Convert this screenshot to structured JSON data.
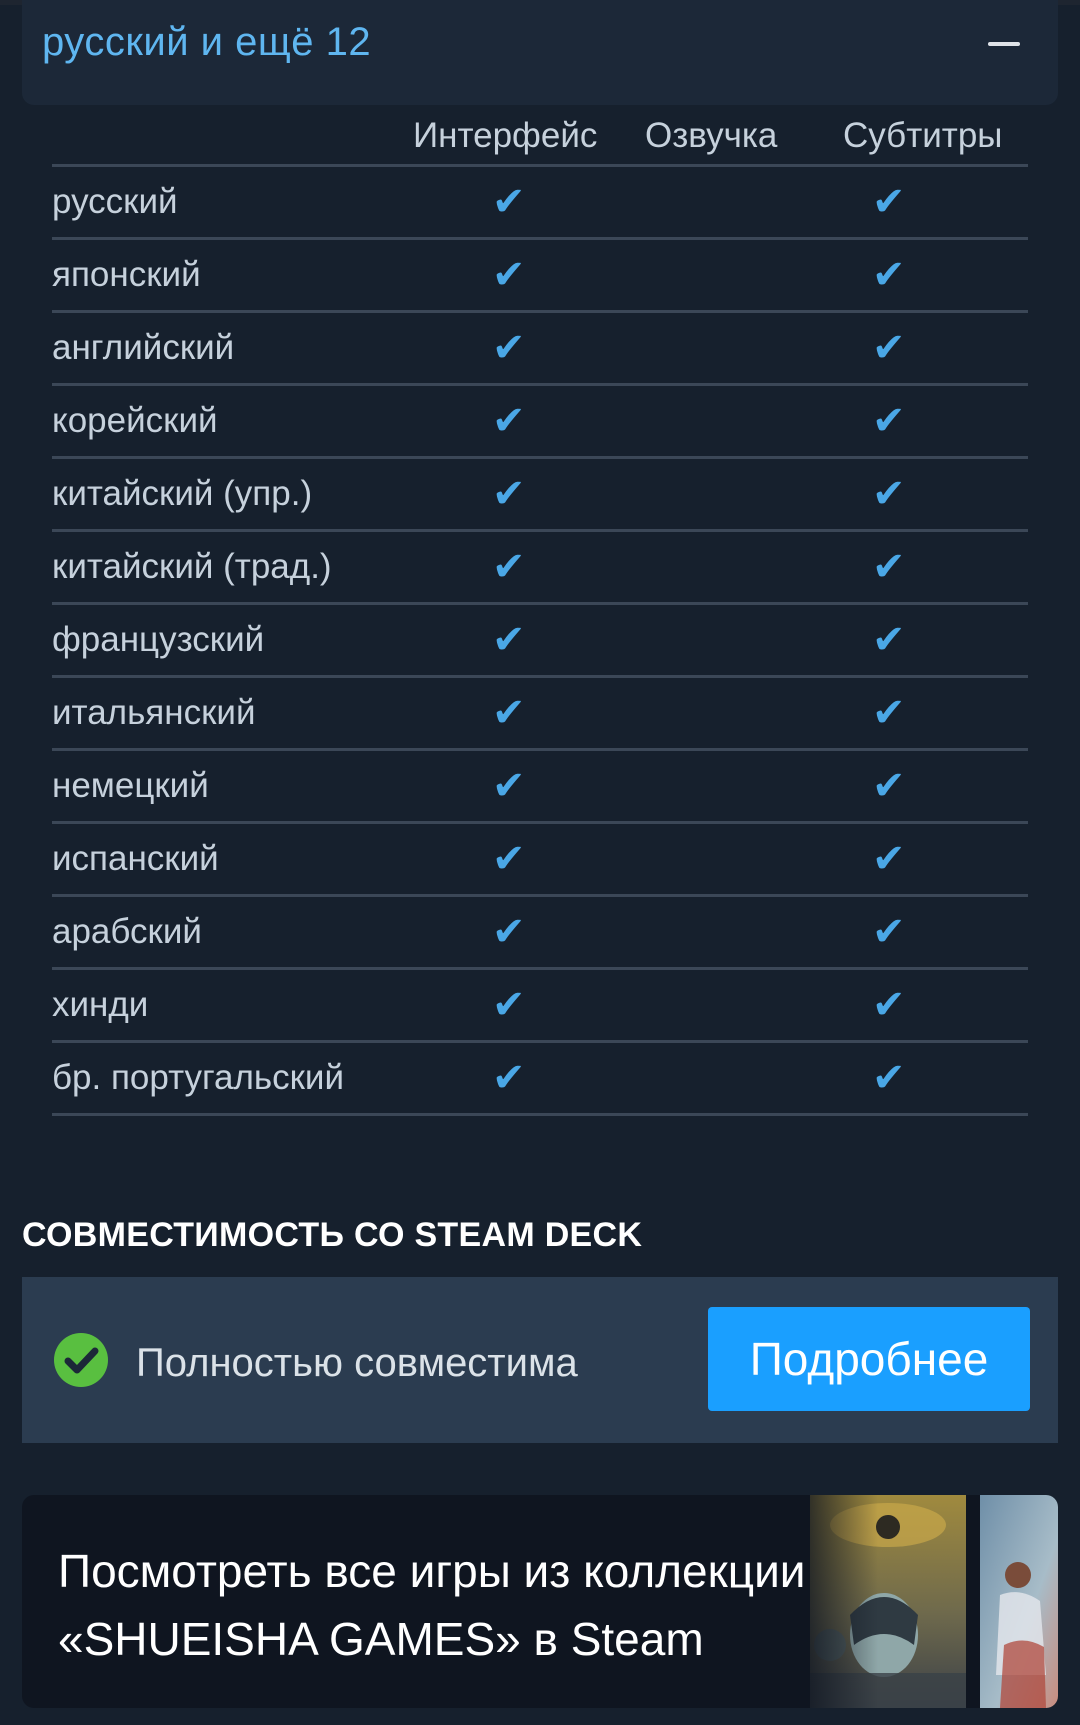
{
  "languages": {
    "title": "русский и ещё 12",
    "columns": [
      "Интерфейс",
      "Озвучка",
      "Субтитры"
    ],
    "check_glyph": "✔",
    "rows": [
      {
        "name": "русский",
        "interface": true,
        "audio": false,
        "subtitles": true
      },
      {
        "name": "японский",
        "interface": true,
        "audio": false,
        "subtitles": true
      },
      {
        "name": "английский",
        "interface": true,
        "audio": false,
        "subtitles": true
      },
      {
        "name": "корейский",
        "interface": true,
        "audio": false,
        "subtitles": true
      },
      {
        "name": "китайский (упр.)",
        "interface": true,
        "audio": false,
        "subtitles": true
      },
      {
        "name": "китайский (трад.)",
        "interface": true,
        "audio": false,
        "subtitles": true
      },
      {
        "name": "французский",
        "interface": true,
        "audio": false,
        "subtitles": true
      },
      {
        "name": "итальянский",
        "interface": true,
        "audio": false,
        "subtitles": true
      },
      {
        "name": "немецкий",
        "interface": true,
        "audio": false,
        "subtitles": true
      },
      {
        "name": "испанский",
        "interface": true,
        "audio": false,
        "subtitles": true
      },
      {
        "name": "арабский",
        "interface": true,
        "audio": false,
        "subtitles": true
      },
      {
        "name": "хинди",
        "interface": true,
        "audio": false,
        "subtitles": true
      },
      {
        "name": "бр. португальский",
        "interface": true,
        "audio": false,
        "subtitles": true
      }
    ]
  },
  "steam_deck": {
    "heading": "СОВМЕСТИМОСТЬ СО STEAM DECK",
    "status": "Полностью совместима",
    "button_label": "Подробнее",
    "status_color": "#59bf40",
    "button_color": "#1a9fff"
  },
  "collection": {
    "line1": "Посмотреть все игры из коллекции",
    "line2": "«SHUEISHA GAMES» в Steam"
  },
  "colors": {
    "background": "#16202d",
    "accent": "#5fb6f0",
    "check": "#4aa7e6"
  }
}
